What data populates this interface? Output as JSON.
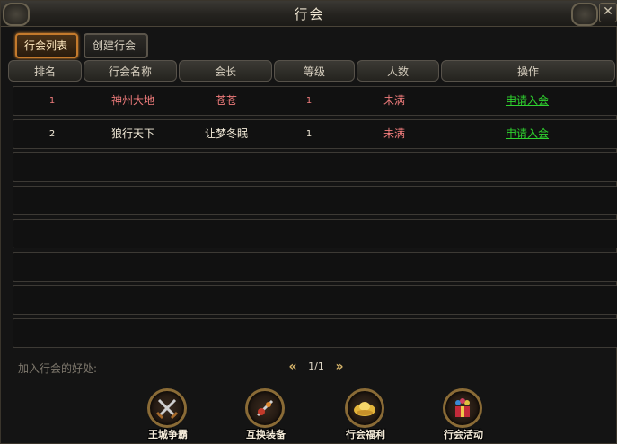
{
  "window": {
    "title": "行会"
  },
  "tabs": [
    {
      "label": "行会列表",
      "active": true
    },
    {
      "label": "创建行会",
      "active": false
    }
  ],
  "table": {
    "headers": [
      "排名",
      "行会名称",
      "会长",
      "等级",
      "人数",
      "操作"
    ],
    "rows": [
      {
        "rank": "1",
        "name": "神州大地",
        "leader": "苍苍",
        "level": "1",
        "members": "未满",
        "action": "申请入会"
      },
      {
        "rank": "2",
        "name": "狼行天下",
        "leader": "让梦冬眠",
        "level": "1",
        "members": "未满",
        "action": "申请入会"
      }
    ],
    "empty_rows": 6
  },
  "footer": {
    "benefits_label": "加入行会的好处:",
    "pagination": {
      "current": "1/1"
    },
    "features": [
      {
        "label": "王城争霸",
        "icon": "crossed-swords-icon"
      },
      {
        "label": "互换装备",
        "icon": "equipment-exchange-icon"
      },
      {
        "label": "行会福利",
        "icon": "gold-ingot-icon"
      },
      {
        "label": "行会活动",
        "icon": "gift-box-icon"
      }
    ]
  },
  "colors": {
    "row1_text": "#f07c7c",
    "row2_text": "#f2ead8",
    "members_text": "#f07c7c",
    "action_link": "#2fd22f",
    "active_tab_border": "#c47a2c"
  }
}
